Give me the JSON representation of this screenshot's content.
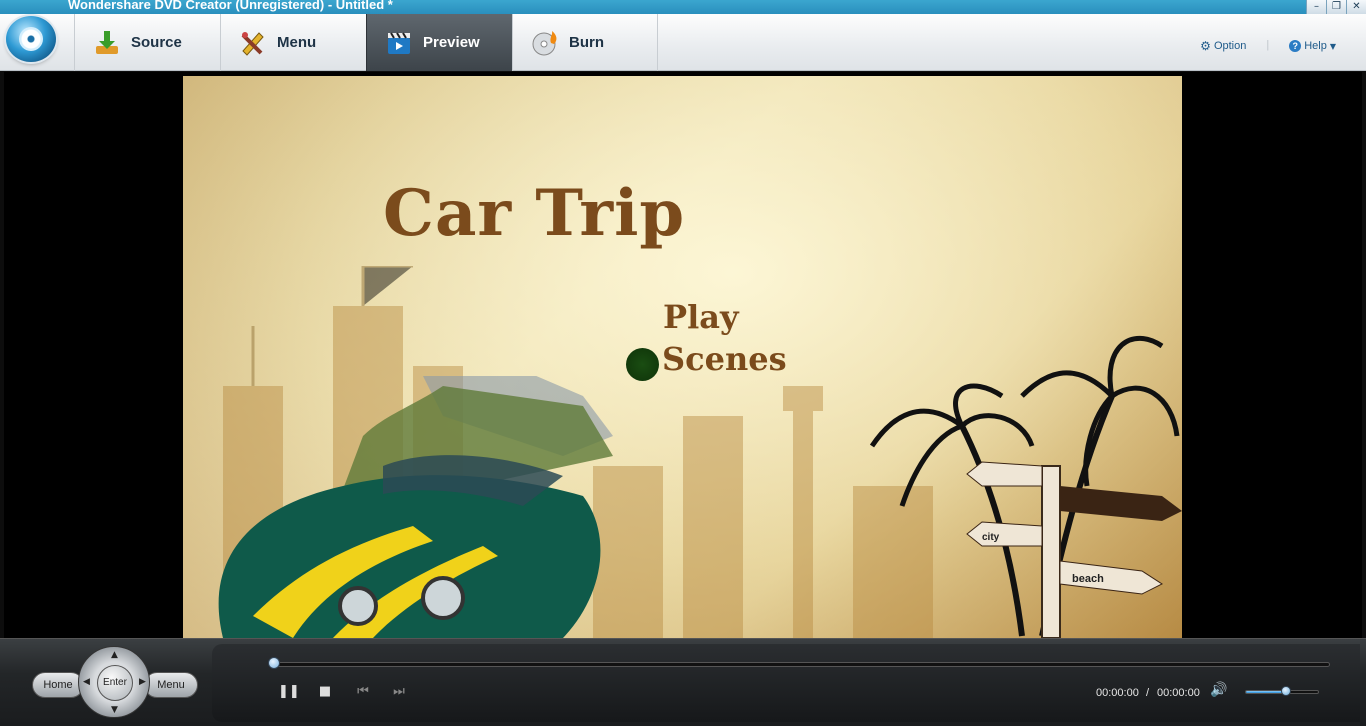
{
  "window": {
    "title": "Wondershare DVD Creator (Unregistered) - Untitled *",
    "buttons": [
      "minimize",
      "restore",
      "close"
    ]
  },
  "toolbar": {
    "tabs": [
      {
        "label": "Source",
        "icon": "import-icon",
        "active": false
      },
      {
        "label": "Menu",
        "icon": "edit-tools-icon",
        "active": false
      },
      {
        "label": "Preview",
        "icon": "clapperboard-icon",
        "active": true
      },
      {
        "label": "Burn",
        "icon": "disc-burn-icon",
        "active": false
      }
    ],
    "option_label": "Option",
    "help_label": "Help"
  },
  "preview": {
    "menu_title": "Car Trip",
    "menu_items": [
      "Play",
      "Scenes"
    ],
    "selected_item": "Scenes",
    "signpost_labels": [
      "city",
      "beach"
    ]
  },
  "remote": {
    "home_label": "Home",
    "enter_label": "Enter",
    "menu_label": "Menu"
  },
  "player": {
    "current_time": "00:00:00",
    "separator": "/",
    "total_time": "00:00:00",
    "progress": 0.0,
    "volume": 0.55,
    "state": "playing"
  },
  "colors": {
    "accent": "#2a8fbd",
    "title_text": "#7b4b1c",
    "active_tab": "#4a5158"
  }
}
